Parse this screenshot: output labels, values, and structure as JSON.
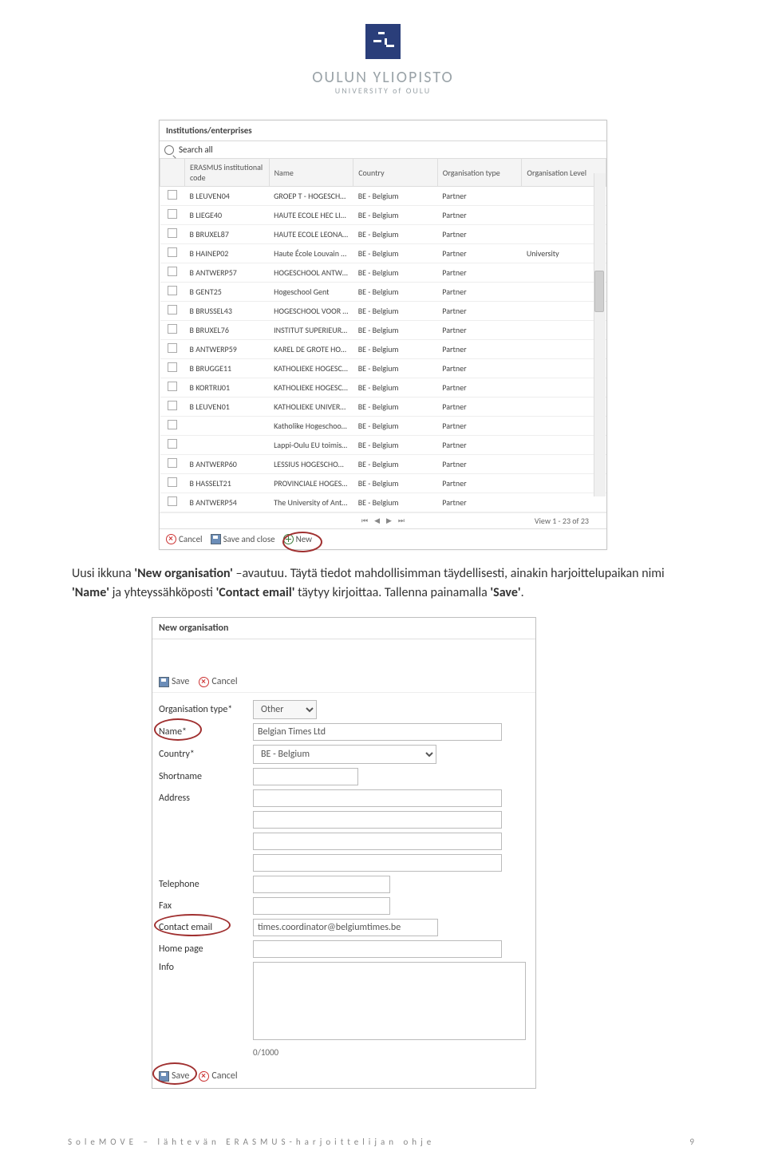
{
  "header": {
    "logo_main": "OULUN YLIOPISTO",
    "logo_sub": "UNIVERSITY of OULU"
  },
  "inst_window": {
    "title": "Institutions/enterprises",
    "search_label": "Search all",
    "columns": [
      "ERASMUS institutional code",
      "Name",
      "Country",
      "Organisation type",
      "Organisation Level"
    ],
    "rows": [
      {
        "code": "B LEUVEN04",
        "name": "GROEP T - HOGESCHOOL LEU",
        "country": "BE - Belgium",
        "type": "Partner",
        "level": ""
      },
      {
        "code": "B LIEGE40",
        "name": "HAUTE ECOLE HEC LIEGE",
        "country": "BE - Belgium",
        "type": "Partner",
        "level": ""
      },
      {
        "code": "B BRUXEL87",
        "name": "HAUTE ECOLE LEONARD DE V",
        "country": "BE - Belgium",
        "type": "Partner",
        "level": ""
      },
      {
        "code": "B HAINEP02",
        "name": "Haute École Louvain en Hain",
        "country": "BE - Belgium",
        "type": "Partner",
        "level": "University"
      },
      {
        "code": "B ANTWERP57",
        "name": "HOGESCHOOL ANTWERPEN",
        "country": "BE - Belgium",
        "type": "Partner",
        "level": ""
      },
      {
        "code": "B GENT25",
        "name": "Hogeschool Gent",
        "country": "BE - Belgium",
        "type": "Partner",
        "level": ""
      },
      {
        "code": "B BRUSSEL43",
        "name": "HOGESCHOOL VOOR WETEN",
        "country": "BE - Belgium",
        "type": "Partner",
        "level": ""
      },
      {
        "code": "B BRUXEL76",
        "name": "INSTITUT SUPERIEUR D'ARCH",
        "country": "BE - Belgium",
        "type": "Partner",
        "level": ""
      },
      {
        "code": "B ANTWERP59",
        "name": "KAREL DE GROTE HOGESCHO",
        "country": "BE - Belgium",
        "type": "Partner",
        "level": ""
      },
      {
        "code": "B BRUGGE11",
        "name": "KATHOLIEKE HOGESCHOOL B",
        "country": "BE - Belgium",
        "type": "Partner",
        "level": ""
      },
      {
        "code": "B KORTRIJ01",
        "name": "KATHOLIEKE HOGESCHOOL Z",
        "country": "BE - Belgium",
        "type": "Partner",
        "level": ""
      },
      {
        "code": "B LEUVEN01",
        "name": "KATHOLIEKE UNIVERSITEIT LE",
        "country": "BE - Belgium",
        "type": "Partner",
        "level": ""
      },
      {
        "code": "",
        "name": "Katholike Hogeschool Brugge",
        "country": "BE - Belgium",
        "type": "Partner",
        "level": ""
      },
      {
        "code": "",
        "name": "Lappi-Oulu EU toimisto Bryss",
        "country": "BE - Belgium",
        "type": "Partner",
        "level": ""
      },
      {
        "code": "B ANTWERP60",
        "name": "LESSIUS HOGESCHOOL ANTW",
        "country": "BE - Belgium",
        "type": "Partner",
        "level": ""
      },
      {
        "code": "B HASSELT21",
        "name": "PROVINCIALE HOGESCHOOL",
        "country": "BE - Belgium",
        "type": "Partner",
        "level": ""
      },
      {
        "code": "B ANTWERP54",
        "name": "The University of Antwerp - F",
        "country": "BE - Belgium",
        "type": "Partner",
        "level": ""
      }
    ],
    "pager": {
      "view": "View 1 - 23 of 23"
    },
    "footer": {
      "cancel": "Cancel",
      "save_close": "Save and close",
      "new": "New"
    }
  },
  "body_paragraph": {
    "t1": "Uusi ikkuna ",
    "b1": "'New organisation'",
    "t2": " –avautuu. Täytä tiedot mahdollisimman täydellisesti, ainakin harjoittelupaikan nimi ",
    "b2": "'Name'",
    "t3": " ja yhteyssähköposti ",
    "b3": "'Contact email'",
    "t4": " täytyy kirjoittaa. Tallenna painamalla ",
    "b4": "'Save'",
    "t5": "."
  },
  "form": {
    "title": "New organisation",
    "save": "Save",
    "cancel": "Cancel",
    "labels": {
      "orgtype": "Organisation type*",
      "name": "Name*",
      "country": "Country*",
      "shortname": "Shortname",
      "address": "Address",
      "telephone": "Telephone",
      "fax": "Fax",
      "contact_email": "Contact email",
      "homepage": "Home page",
      "info": "Info"
    },
    "values": {
      "orgtype": "Other",
      "name": "Belgian Times Ltd",
      "country": "BE - Belgium",
      "shortname": "",
      "address1": "",
      "address2": "",
      "address3": "",
      "address4": "",
      "telephone": "",
      "fax": "",
      "contact_email": "times.coordinator@belgiumtimes.be",
      "homepage": "",
      "info": ""
    },
    "counter": "0/1000"
  },
  "footer": {
    "left": "SoleMOVE – lähtevän ERASMUS-harjoittelijan ohje",
    "right": "9"
  }
}
